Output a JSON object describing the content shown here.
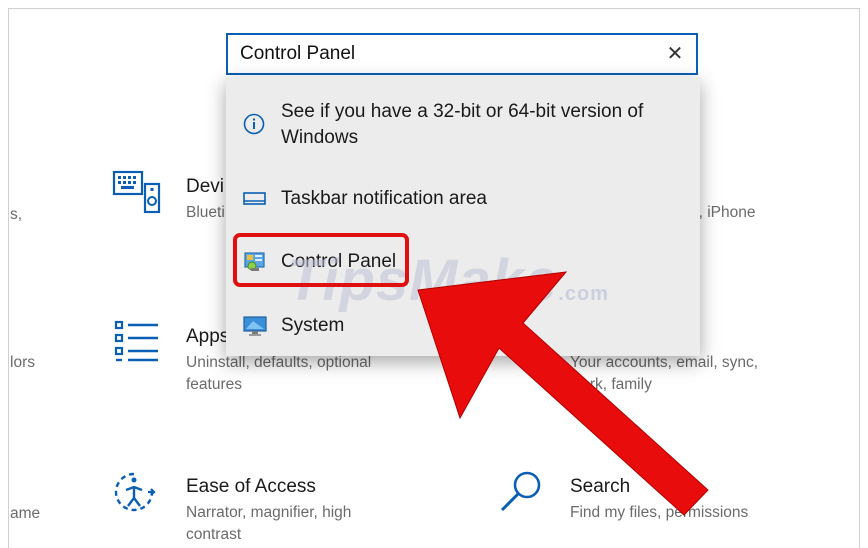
{
  "search": {
    "value": "Control Panel",
    "clear_icon": "close-icon"
  },
  "results": [
    {
      "label": "See if you have a 32-bit or 64-bit version of Windows",
      "line1": "See if you have a 32-bit or 64-bit version of",
      "line2": "Windows",
      "icon": "info-icon"
    },
    {
      "label": "Taskbar notification area",
      "icon": "taskbar-icon"
    },
    {
      "label": "Control Panel",
      "icon": "control-panel-icon"
    },
    {
      "label": "System",
      "icon": "monitor-icon"
    }
  ],
  "tiles": {
    "devices": {
      "title": "Devi",
      "sub": "Blueti",
      "icon": "devices-icon"
    },
    "apps": {
      "title": "Apps",
      "sub1": "Uninstall, defaults, optional",
      "sub2": "features",
      "icon": "apps-list-icon"
    },
    "accounts": {
      "sub1": "Your accounts, email, sync,",
      "sub2": "work, family"
    },
    "phone": {
      "sub": "d, iPhone"
    },
    "ease": {
      "title": "Ease of Access",
      "sub1": "Narrator, magnifier, high",
      "sub2": "contrast",
      "icon": "ease-of-access-icon"
    },
    "search": {
      "title": "Search",
      "sub": "Find my files, permissions",
      "icon": "search-icon"
    }
  },
  "edge_text": {
    "a": "s,",
    "b": "lors",
    "c": "ame"
  },
  "watermark": {
    "main": "TipsMake",
    "suffix": ".com"
  },
  "colors": {
    "accent": "#0a5fb4",
    "annotation_red": "#e01010"
  }
}
